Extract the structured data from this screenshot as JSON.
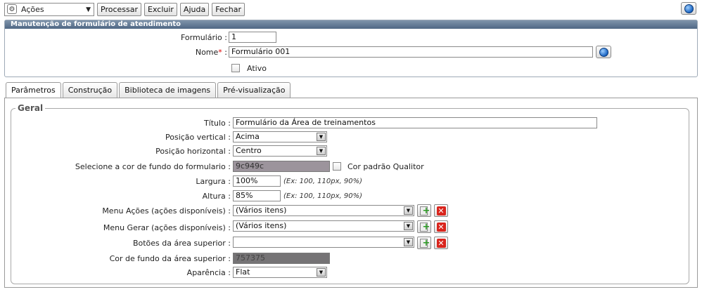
{
  "toolbar": {
    "actions_select": "Ações",
    "buttons": [
      "Processar",
      "Excluir",
      "Ajuda",
      "Fechar"
    ]
  },
  "header_panel": {
    "title": "Manutenção de formulário de atendimento",
    "formulario_label": "Formulário :",
    "formulario_value": "1",
    "nome_label": "Nome",
    "nome_suffix": " :",
    "required_mark": "*",
    "nome_value": "Formulário 001",
    "ativo_label": "Ativo"
  },
  "tabs": [
    "Parâmetros",
    "Construção",
    "Biblioteca de imagens",
    "Pré-visualização"
  ],
  "geral": {
    "legend": "Geral",
    "titulo_label": "Título :",
    "titulo_value": "Formulário da Área de treinamentos",
    "pos_vertical_label": "Posição vertical :",
    "pos_vertical_value": "Acima",
    "pos_horizontal_label": "Posição horizontal :",
    "pos_horizontal_value": "Centro",
    "cor_fundo_label": "Selecione a cor de fundo do formulario :",
    "cor_fundo_value": "9c949c",
    "cor_fundo_color": "#9c949c",
    "cor_padrao_label": "Cor padrão Qualitor",
    "largura_label": "Largura :",
    "largura_value": "100%",
    "largura_hint": "(Ex: 100, 110px, 90%)",
    "altura_label": "Altura :",
    "altura_value": "85%",
    "altura_hint": "(Ex: 100, 110px, 90%)",
    "menu_acoes_label": "Menu Ações (ações disponíveis) :",
    "menu_acoes_value": "(Vários itens)",
    "menu_gerar_label": "Menu Gerar (ações disponíveis) :",
    "menu_gerar_value": "(Vários itens)",
    "botoes_label": "Botões da área superior :",
    "botoes_value": "",
    "cor_superior_label": "Cor de fundo da área superior :",
    "cor_superior_value": "757375",
    "cor_superior_color": "#757375",
    "aparencia_label": "Aparência :",
    "aparencia_value": "Flat"
  },
  "colors": {
    "panel_header": "#5a7190",
    "required": "#dd0000"
  }
}
